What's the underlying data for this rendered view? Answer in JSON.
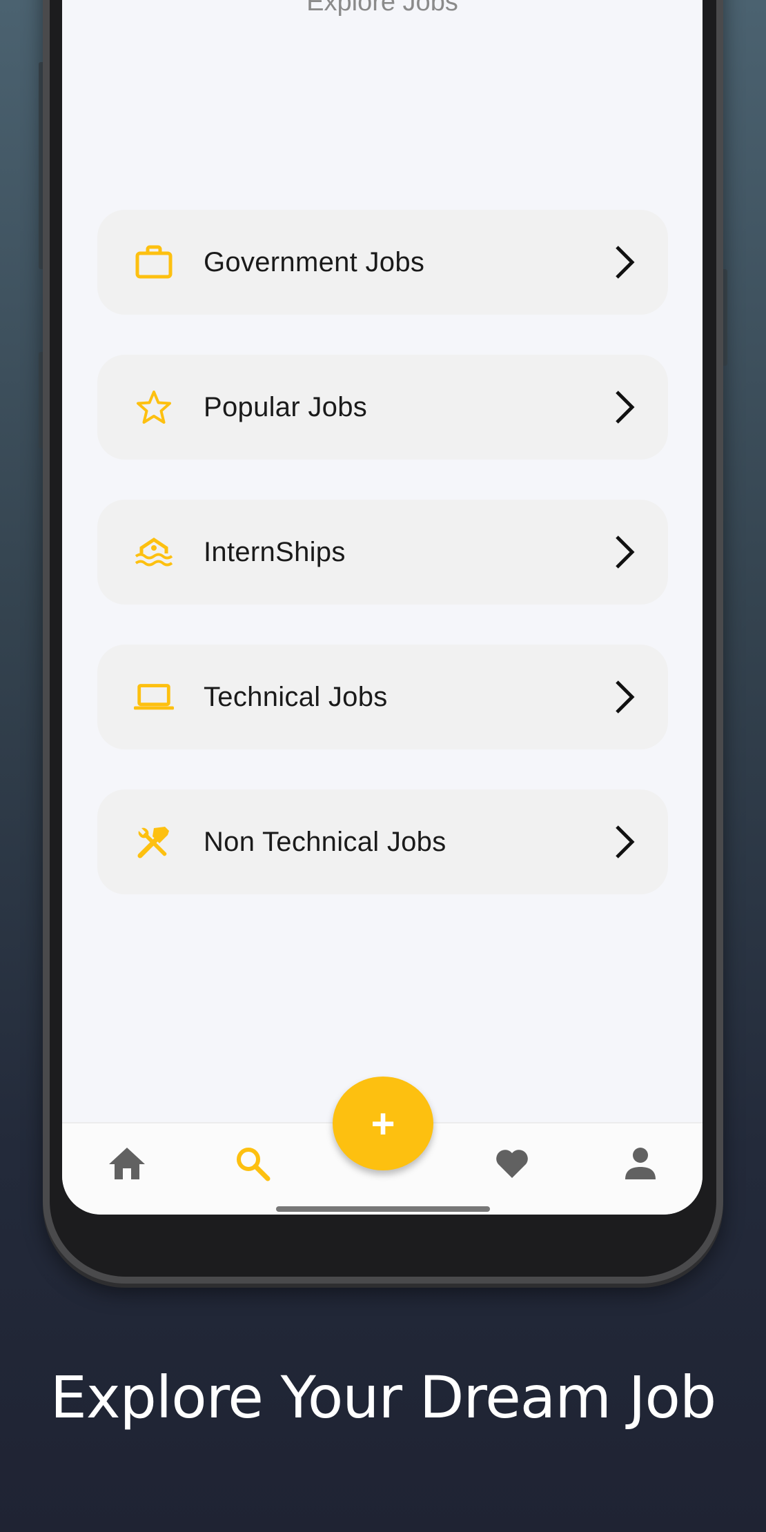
{
  "screen": {
    "title": "Explore Jobs"
  },
  "menu": {
    "items": [
      {
        "label": "Government Jobs",
        "icon": "briefcase-icon"
      },
      {
        "label": "Popular Jobs",
        "icon": "star-icon"
      },
      {
        "label": "InternShips",
        "icon": "pool-icon"
      },
      {
        "label": "Technical Jobs",
        "icon": "laptop-icon"
      },
      {
        "label": "Non Technical Jobs",
        "icon": "tools-icon"
      }
    ],
    "trailing_icon": "chevron-right-icon"
  },
  "bottom_nav": {
    "items": [
      {
        "icon": "home-icon",
        "active": false
      },
      {
        "icon": "search-icon",
        "active": true
      },
      {
        "icon": "heart-icon",
        "active": false
      },
      {
        "icon": "person-icon",
        "active": false
      }
    ],
    "fab": {
      "icon": "plus-icon",
      "label": "+"
    }
  },
  "caption": "Explore Your Dream Job",
  "colors": {
    "accent": "#FDC010",
    "nav_inactive": "#616161",
    "item_background": "#F1F1F1",
    "screen_background": "#F5F6FA",
    "text": "#1A1A1A"
  }
}
